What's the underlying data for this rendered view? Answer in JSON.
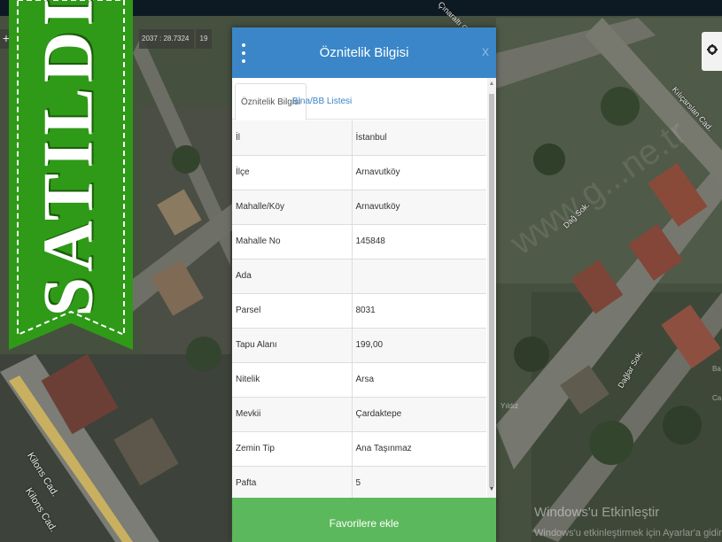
{
  "map": {
    "coord_text": "2037 : 28.7324",
    "zoom_text": "19",
    "plus_label": "+",
    "streets": [
      "Kılıçarslan Cad.",
      "Kilons Cad.",
      "Kilons Cad.",
      "Dağ Sok.",
      "Dağlar Sok.",
      "Çınaraltı Cad."
    ],
    "watermark": "www.g...ne.tr",
    "faint_label_1": "Yıldız",
    "faint_label_2": "Ba",
    "faint_label_3": "Ca",
    "windows_line1": "Windows'u Etkinleştir",
    "windows_line2": "Windows'u etkinleştirmek için Ayarlar'a gidin."
  },
  "banner": {
    "text": "SATILDI",
    "color": "#2e9a17"
  },
  "dialog": {
    "title": "Öznitelik Bilgisi",
    "close_label": "x",
    "tabs": [
      {
        "label": "Öznitelik Bilgisi"
      },
      {
        "label": "Bina/BB Listesi"
      }
    ],
    "rows": [
      {
        "key": "İl",
        "value": "İstanbul"
      },
      {
        "key": "İlçe",
        "value": "Arnavutköy"
      },
      {
        "key": "Mahalle/Köy",
        "value": "Arnavutköy"
      },
      {
        "key": "Mahalle No",
        "value": "145848"
      },
      {
        "key": "Ada",
        "value": ""
      },
      {
        "key": "Parsel",
        "value": "8031"
      },
      {
        "key": "Tapu Alanı",
        "value": "199,00"
      },
      {
        "key": "Nitelik",
        "value": "Arsa"
      },
      {
        "key": "Mevkii",
        "value": "Çardaktepe"
      },
      {
        "key": "Zemin Tip",
        "value": "Ana Taşınmaz"
      },
      {
        "key": "Pafta",
        "value": "5"
      }
    ],
    "favorite_button": "Favorilere ekle",
    "header_color": "#3a86c8",
    "button_color": "#5cb85c"
  }
}
